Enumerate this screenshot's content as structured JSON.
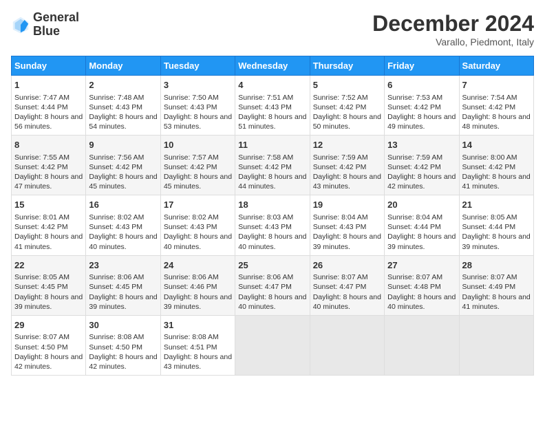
{
  "logo": {
    "line1": "General",
    "line2": "Blue"
  },
  "title": "December 2024",
  "subtitle": "Varallo, Piedmont, Italy",
  "days_of_week": [
    "Sunday",
    "Monday",
    "Tuesday",
    "Wednesday",
    "Thursday",
    "Friday",
    "Saturday"
  ],
  "weeks": [
    [
      {
        "day": "1",
        "sunrise": "Sunrise: 7:47 AM",
        "sunset": "Sunset: 4:44 PM",
        "daylight": "Daylight: 8 hours and 56 minutes."
      },
      {
        "day": "2",
        "sunrise": "Sunrise: 7:48 AM",
        "sunset": "Sunset: 4:43 PM",
        "daylight": "Daylight: 8 hours and 54 minutes."
      },
      {
        "day": "3",
        "sunrise": "Sunrise: 7:50 AM",
        "sunset": "Sunset: 4:43 PM",
        "daylight": "Daylight: 8 hours and 53 minutes."
      },
      {
        "day": "4",
        "sunrise": "Sunrise: 7:51 AM",
        "sunset": "Sunset: 4:43 PM",
        "daylight": "Daylight: 8 hours and 51 minutes."
      },
      {
        "day": "5",
        "sunrise": "Sunrise: 7:52 AM",
        "sunset": "Sunset: 4:42 PM",
        "daylight": "Daylight: 8 hours and 50 minutes."
      },
      {
        "day": "6",
        "sunrise": "Sunrise: 7:53 AM",
        "sunset": "Sunset: 4:42 PM",
        "daylight": "Daylight: 8 hours and 49 minutes."
      },
      {
        "day": "7",
        "sunrise": "Sunrise: 7:54 AM",
        "sunset": "Sunset: 4:42 PM",
        "daylight": "Daylight: 8 hours and 48 minutes."
      }
    ],
    [
      {
        "day": "8",
        "sunrise": "Sunrise: 7:55 AM",
        "sunset": "Sunset: 4:42 PM",
        "daylight": "Daylight: 8 hours and 47 minutes."
      },
      {
        "day": "9",
        "sunrise": "Sunrise: 7:56 AM",
        "sunset": "Sunset: 4:42 PM",
        "daylight": "Daylight: 8 hours and 45 minutes."
      },
      {
        "day": "10",
        "sunrise": "Sunrise: 7:57 AM",
        "sunset": "Sunset: 4:42 PM",
        "daylight": "Daylight: 8 hours and 45 minutes."
      },
      {
        "day": "11",
        "sunrise": "Sunrise: 7:58 AM",
        "sunset": "Sunset: 4:42 PM",
        "daylight": "Daylight: 8 hours and 44 minutes."
      },
      {
        "day": "12",
        "sunrise": "Sunrise: 7:59 AM",
        "sunset": "Sunset: 4:42 PM",
        "daylight": "Daylight: 8 hours and 43 minutes."
      },
      {
        "day": "13",
        "sunrise": "Sunrise: 7:59 AM",
        "sunset": "Sunset: 4:42 PM",
        "daylight": "Daylight: 8 hours and 42 minutes."
      },
      {
        "day": "14",
        "sunrise": "Sunrise: 8:00 AM",
        "sunset": "Sunset: 4:42 PM",
        "daylight": "Daylight: 8 hours and 41 minutes."
      }
    ],
    [
      {
        "day": "15",
        "sunrise": "Sunrise: 8:01 AM",
        "sunset": "Sunset: 4:42 PM",
        "daylight": "Daylight: 8 hours and 41 minutes."
      },
      {
        "day": "16",
        "sunrise": "Sunrise: 8:02 AM",
        "sunset": "Sunset: 4:43 PM",
        "daylight": "Daylight: 8 hours and 40 minutes."
      },
      {
        "day": "17",
        "sunrise": "Sunrise: 8:02 AM",
        "sunset": "Sunset: 4:43 PM",
        "daylight": "Daylight: 8 hours and 40 minutes."
      },
      {
        "day": "18",
        "sunrise": "Sunrise: 8:03 AM",
        "sunset": "Sunset: 4:43 PM",
        "daylight": "Daylight: 8 hours and 40 minutes."
      },
      {
        "day": "19",
        "sunrise": "Sunrise: 8:04 AM",
        "sunset": "Sunset: 4:43 PM",
        "daylight": "Daylight: 8 hours and 39 minutes."
      },
      {
        "day": "20",
        "sunrise": "Sunrise: 8:04 AM",
        "sunset": "Sunset: 4:44 PM",
        "daylight": "Daylight: 8 hours and 39 minutes."
      },
      {
        "day": "21",
        "sunrise": "Sunrise: 8:05 AM",
        "sunset": "Sunset: 4:44 PM",
        "daylight": "Daylight: 8 hours and 39 minutes."
      }
    ],
    [
      {
        "day": "22",
        "sunrise": "Sunrise: 8:05 AM",
        "sunset": "Sunset: 4:45 PM",
        "daylight": "Daylight: 8 hours and 39 minutes."
      },
      {
        "day": "23",
        "sunrise": "Sunrise: 8:06 AM",
        "sunset": "Sunset: 4:45 PM",
        "daylight": "Daylight: 8 hours and 39 minutes."
      },
      {
        "day": "24",
        "sunrise": "Sunrise: 8:06 AM",
        "sunset": "Sunset: 4:46 PM",
        "daylight": "Daylight: 8 hours and 39 minutes."
      },
      {
        "day": "25",
        "sunrise": "Sunrise: 8:06 AM",
        "sunset": "Sunset: 4:47 PM",
        "daylight": "Daylight: 8 hours and 40 minutes."
      },
      {
        "day": "26",
        "sunrise": "Sunrise: 8:07 AM",
        "sunset": "Sunset: 4:47 PM",
        "daylight": "Daylight: 8 hours and 40 minutes."
      },
      {
        "day": "27",
        "sunrise": "Sunrise: 8:07 AM",
        "sunset": "Sunset: 4:48 PM",
        "daylight": "Daylight: 8 hours and 40 minutes."
      },
      {
        "day": "28",
        "sunrise": "Sunrise: 8:07 AM",
        "sunset": "Sunset: 4:49 PM",
        "daylight": "Daylight: 8 hours and 41 minutes."
      }
    ],
    [
      {
        "day": "29",
        "sunrise": "Sunrise: 8:07 AM",
        "sunset": "Sunset: 4:50 PM",
        "daylight": "Daylight: 8 hours and 42 minutes."
      },
      {
        "day": "30",
        "sunrise": "Sunrise: 8:08 AM",
        "sunset": "Sunset: 4:50 PM",
        "daylight": "Daylight: 8 hours and 42 minutes."
      },
      {
        "day": "31",
        "sunrise": "Sunrise: 8:08 AM",
        "sunset": "Sunset: 4:51 PM",
        "daylight": "Daylight: 8 hours and 43 minutes."
      },
      null,
      null,
      null,
      null
    ]
  ]
}
